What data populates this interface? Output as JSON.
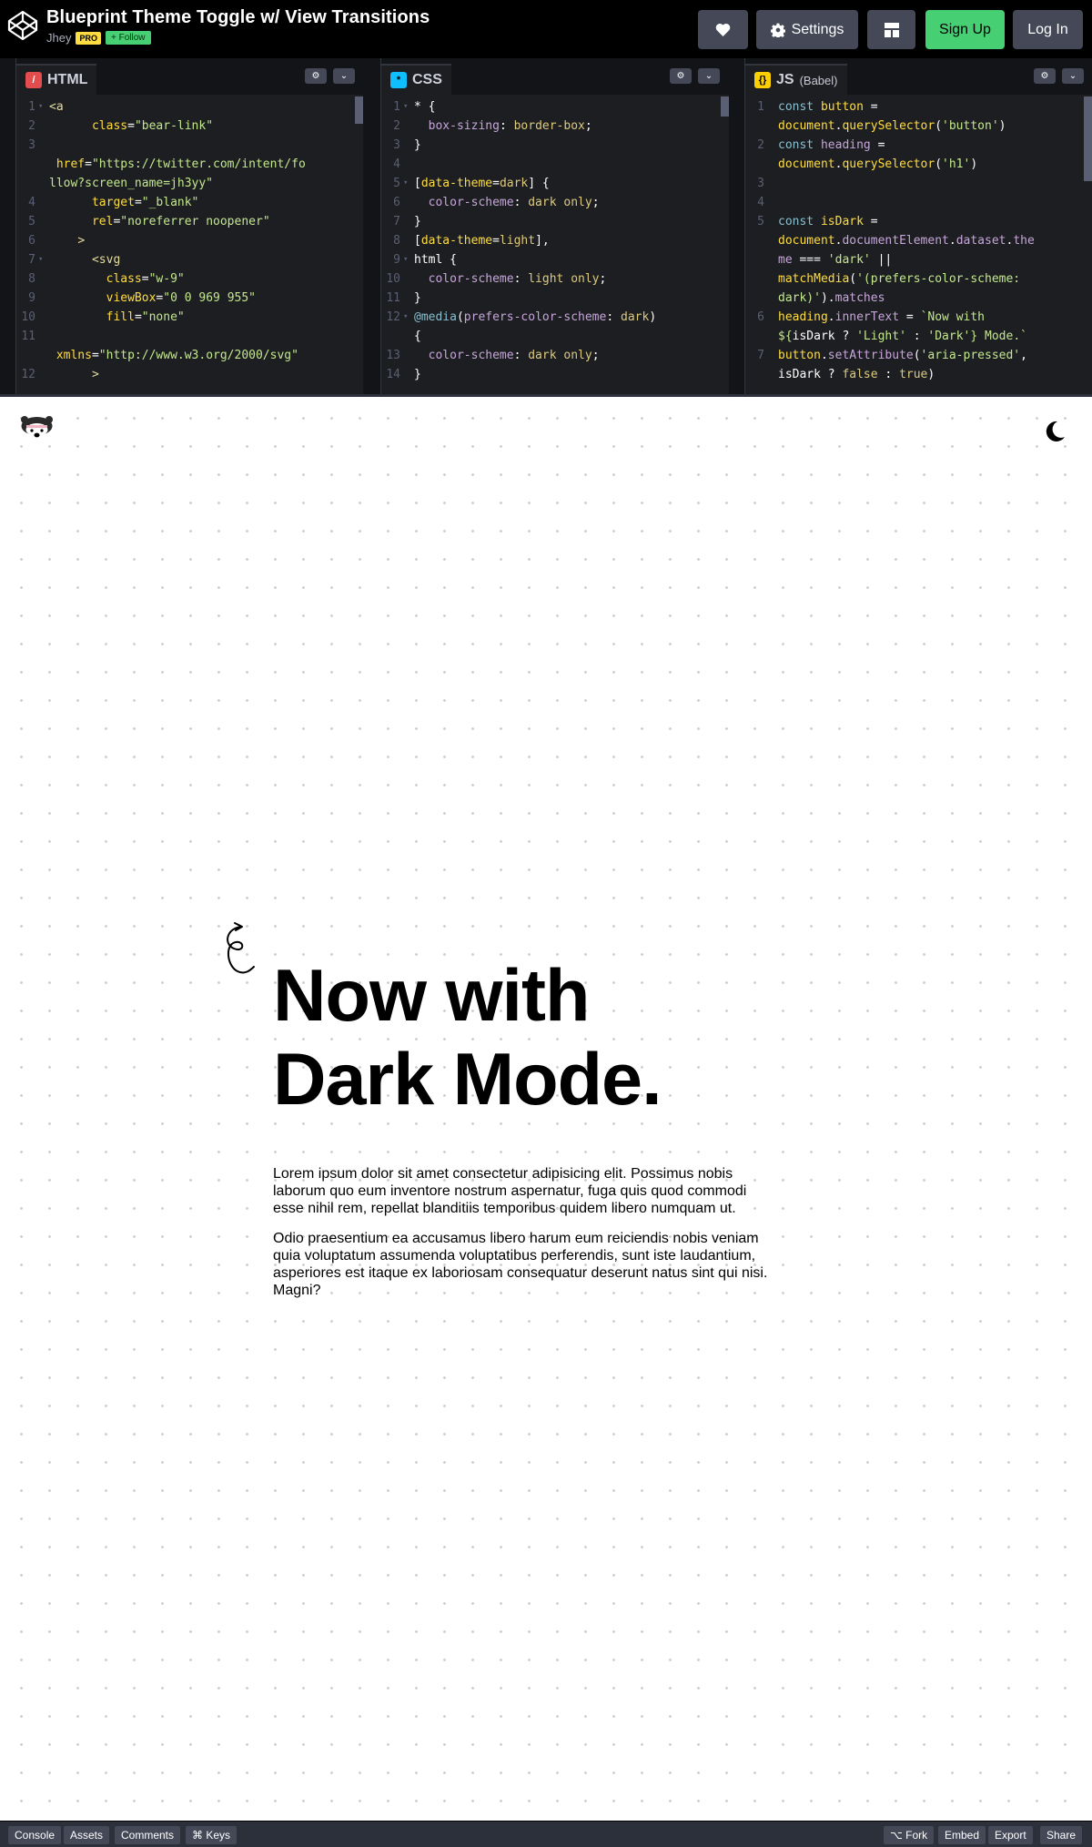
{
  "header": {
    "pen_title": "Blueprint Theme Toggle w/ View Transitions",
    "author": "Jhey",
    "pro_badge": "PRO",
    "follow_label": "+ Follow",
    "settings_label": "Settings",
    "signup_label": "Sign Up",
    "login_label": "Log In"
  },
  "editors": {
    "html": {
      "tab_label": "HTML",
      "lines": [
        {
          "n": "1",
          "fold": "▾",
          "segs": [
            [
              "c-tag",
              "<a"
            ]
          ]
        },
        {
          "n": "2",
          "fold": "",
          "segs": [
            [
              "txt",
              "      "
            ],
            [
              "c-attr",
              "class"
            ],
            [
              "txt",
              "="
            ],
            [
              "c-str2",
              "\"bear-link\""
            ]
          ]
        },
        {
          "n": "3",
          "fold": "",
          "segs": [
            [
              "txt",
              ""
            ]
          ]
        },
        {
          "n": "",
          "fold": "",
          "segs": [
            [
              "txt",
              " "
            ],
            [
              "c-attr",
              "href"
            ],
            [
              "txt",
              "="
            ],
            [
              "c-str2",
              "\"https://twitter.com/intent/fo"
            ]
          ]
        },
        {
          "n": "",
          "fold": "",
          "segs": [
            [
              "c-str2",
              "llow?screen_name=jh3yy\""
            ]
          ]
        },
        {
          "n": "4",
          "fold": "",
          "segs": [
            [
              "txt",
              "      "
            ],
            [
              "c-attr",
              "target"
            ],
            [
              "txt",
              "="
            ],
            [
              "c-str2",
              "\"_blank\""
            ]
          ]
        },
        {
          "n": "5",
          "fold": "",
          "segs": [
            [
              "txt",
              "      "
            ],
            [
              "c-attr",
              "rel"
            ],
            [
              "txt",
              "="
            ],
            [
              "c-str2",
              "\"noreferrer noopener\""
            ]
          ]
        },
        {
          "n": "6",
          "fold": "",
          "segs": [
            [
              "txt",
              "    "
            ],
            [
              "c-tag",
              ">"
            ]
          ]
        },
        {
          "n": "7",
          "fold": "▾",
          "segs": [
            [
              "txt",
              "      "
            ],
            [
              "c-tag",
              "<svg"
            ]
          ]
        },
        {
          "n": "8",
          "fold": "",
          "segs": [
            [
              "txt",
              "        "
            ],
            [
              "c-attr",
              "class"
            ],
            [
              "txt",
              "="
            ],
            [
              "c-str2",
              "\"w-9\""
            ]
          ]
        },
        {
          "n": "9",
          "fold": "",
          "segs": [
            [
              "txt",
              "        "
            ],
            [
              "c-attr",
              "viewBox"
            ],
            [
              "txt",
              "="
            ],
            [
              "c-str2",
              "\"0 0 969 955\""
            ]
          ]
        },
        {
          "n": "10",
          "fold": "",
          "segs": [
            [
              "txt",
              "        "
            ],
            [
              "c-attr",
              "fill"
            ],
            [
              "txt",
              "="
            ],
            [
              "c-str2",
              "\"none\""
            ]
          ]
        },
        {
          "n": "11",
          "fold": "",
          "segs": [
            [
              "txt",
              ""
            ]
          ]
        },
        {
          "n": "",
          "fold": "",
          "segs": [
            [
              "txt",
              " "
            ],
            [
              "c-attr",
              "xmlns"
            ],
            [
              "txt",
              "="
            ],
            [
              "c-str2",
              "\"http://www.w3.org/2000/svg\""
            ]
          ]
        },
        {
          "n": "12",
          "fold": "",
          "segs": [
            [
              "txt",
              "      "
            ],
            [
              "c-tag",
              ">"
            ]
          ]
        }
      ]
    },
    "css": {
      "tab_label": "CSS",
      "lines": [
        {
          "n": "1",
          "fold": "▾",
          "segs": [
            [
              "txt",
              "* {"
            ]
          ]
        },
        {
          "n": "2",
          "fold": "",
          "segs": [
            [
              "txt",
              "  "
            ],
            [
              "c-prop",
              "box-sizing"
            ],
            [
              "txt",
              ": "
            ],
            [
              "c-kw",
              "border-box"
            ],
            [
              "txt",
              ";"
            ]
          ]
        },
        {
          "n": "3",
          "fold": "",
          "segs": [
            [
              "txt",
              "}"
            ]
          ]
        },
        {
          "n": "4",
          "fold": "",
          "segs": [
            [
              "txt",
              ""
            ]
          ]
        },
        {
          "n": "5",
          "fold": "▾",
          "segs": [
            [
              "txt",
              "["
            ],
            [
              "c-sel",
              "data-theme"
            ],
            [
              "txt",
              "="
            ],
            [
              "c-kw",
              "dark"
            ],
            [
              "txt",
              "] {"
            ]
          ]
        },
        {
          "n": "6",
          "fold": "",
          "segs": [
            [
              "txt",
              "  "
            ],
            [
              "c-prop",
              "color-scheme"
            ],
            [
              "txt",
              ": "
            ],
            [
              "c-kw",
              "dark only"
            ],
            [
              "txt",
              ";"
            ]
          ]
        },
        {
          "n": "7",
          "fold": "",
          "segs": [
            [
              "txt",
              "}"
            ]
          ]
        },
        {
          "n": "8",
          "fold": "",
          "segs": [
            [
              "txt",
              "["
            ],
            [
              "c-sel",
              "data-theme"
            ],
            [
              "txt",
              "="
            ],
            [
              "c-kw",
              "light"
            ],
            [
              "txt",
              "],"
            ]
          ]
        },
        {
          "n": "9",
          "fold": "▾",
          "segs": [
            [
              "txt",
              "html {"
            ]
          ]
        },
        {
          "n": "10",
          "fold": "",
          "segs": [
            [
              "txt",
              "  "
            ],
            [
              "c-prop",
              "color-scheme"
            ],
            [
              "txt",
              ": "
            ],
            [
              "c-kw",
              "light only"
            ],
            [
              "txt",
              ";"
            ]
          ]
        },
        {
          "n": "11",
          "fold": "",
          "segs": [
            [
              "txt",
              "}"
            ]
          ]
        },
        {
          "n": "12",
          "fold": "▾",
          "segs": [
            [
              "c-key",
              "@media"
            ],
            [
              "txt",
              "("
            ],
            [
              "c-prop",
              "prefers-color-scheme"
            ],
            [
              "txt",
              ": "
            ],
            [
              "c-kw",
              "dark"
            ],
            [
              "txt",
              ")"
            ]
          ]
        },
        {
          "n": "",
          "fold": "",
          "segs": [
            [
              "txt",
              "{"
            ]
          ]
        },
        {
          "n": "13",
          "fold": "",
          "segs": [
            [
              "txt",
              "  "
            ],
            [
              "c-prop",
              "color-scheme"
            ],
            [
              "txt",
              ": "
            ],
            [
              "c-kw",
              "dark only"
            ],
            [
              "txt",
              ";"
            ]
          ]
        },
        {
          "n": "14",
          "fold": "",
          "segs": [
            [
              "txt",
              "}"
            ]
          ]
        }
      ]
    },
    "js": {
      "tab_label": "JS",
      "tab_sub": "(Babel)",
      "lines": [
        {
          "n": "1",
          "fold": "",
          "segs": [
            [
              "c-key",
              "const "
            ],
            [
              "c-fn",
              "button"
            ],
            [
              "txt",
              " ="
            ]
          ]
        },
        {
          "n": "",
          "fold": "",
          "segs": [
            [
              "c-fn",
              "document"
            ],
            [
              "txt",
              "."
            ],
            [
              "c-fn",
              "querySelector"
            ],
            [
              "txt",
              "("
            ],
            [
              "c-str2",
              "'button'"
            ],
            [
              "txt",
              ")"
            ]
          ]
        },
        {
          "n": "2",
          "fold": "",
          "segs": [
            [
              "c-key",
              "const "
            ],
            [
              "c-prop",
              "heading"
            ],
            [
              "txt",
              " ="
            ]
          ]
        },
        {
          "n": "",
          "fold": "",
          "segs": [
            [
              "c-fn",
              "document"
            ],
            [
              "txt",
              "."
            ],
            [
              "c-fn",
              "querySelector"
            ],
            [
              "txt",
              "("
            ],
            [
              "c-str2",
              "'h1'"
            ],
            [
              "txt",
              ")"
            ]
          ]
        },
        {
          "n": "3",
          "fold": "",
          "segs": [
            [
              "txt",
              ""
            ]
          ]
        },
        {
          "n": "4",
          "fold": "",
          "segs": [
            [
              "txt",
              ""
            ]
          ]
        },
        {
          "n": "5",
          "fold": "",
          "segs": [
            [
              "c-key",
              "const "
            ],
            [
              "c-fn",
              "isDark"
            ],
            [
              "txt",
              " ="
            ]
          ]
        },
        {
          "n": "",
          "fold": "",
          "segs": [
            [
              "c-fn",
              "document"
            ],
            [
              "txt",
              "."
            ],
            [
              "c-prop",
              "documentElement"
            ],
            [
              "txt",
              "."
            ],
            [
              "c-prop",
              "dataset"
            ],
            [
              "txt",
              "."
            ],
            [
              "c-prop",
              "the"
            ]
          ]
        },
        {
          "n": "",
          "fold": "",
          "segs": [
            [
              "c-prop",
              "me"
            ],
            [
              "txt",
              " === "
            ],
            [
              "c-str2",
              "'dark'"
            ],
            [
              "txt",
              " ||"
            ]
          ]
        },
        {
          "n": "",
          "fold": "",
          "segs": [
            [
              "c-fn",
              "matchMedia"
            ],
            [
              "txt",
              "("
            ],
            [
              "c-str2",
              "'(prefers-color-scheme:"
            ]
          ]
        },
        {
          "n": "",
          "fold": "",
          "segs": [
            [
              "c-str2",
              "dark)'"
            ],
            [
              "txt",
              ")."
            ],
            [
              "c-prop",
              "matches"
            ]
          ]
        },
        {
          "n": "6",
          "fold": "",
          "segs": [
            [
              "c-fn",
              "heading"
            ],
            [
              "txt",
              "."
            ],
            [
              "c-prop",
              "innerText"
            ],
            [
              "txt",
              " = "
            ],
            [
              "c-str2",
              "`Now with"
            ]
          ]
        },
        {
          "n": "",
          "fold": "",
          "segs": [
            [
              "c-str2",
              "${"
            ],
            [
              "txt",
              "isDark ? "
            ],
            [
              "c-str2",
              "'Light'"
            ],
            [
              "txt",
              " : "
            ],
            [
              "c-str2",
              "'Dark'"
            ],
            [
              "c-str2",
              "} Mode.`"
            ]
          ]
        },
        {
          "n": "7",
          "fold": "",
          "segs": [
            [
              "c-fn",
              "button"
            ],
            [
              "txt",
              "."
            ],
            [
              "c-prop",
              "setAttribute"
            ],
            [
              "txt",
              "("
            ],
            [
              "c-str2",
              "'aria-pressed'"
            ],
            [
              "txt",
              ","
            ]
          ]
        },
        {
          "n": "",
          "fold": "",
          "segs": [
            [
              "txt",
              "isDark ? "
            ],
            [
              "c-kw",
              "false"
            ],
            [
              "txt",
              " : "
            ],
            [
              "c-kw",
              "true"
            ],
            [
              "txt",
              ")"
            ]
          ]
        }
      ]
    }
  },
  "preview": {
    "heading_line1": "Now with",
    "heading_line2": "Dark Mode.",
    "paragraph1": "Lorem ipsum dolor sit amet consectetur adipisicing elit. Possimus nobis laborum quo eum inventore nostrum aspernatur, fuga quis quod commodi esse nihil rem, repellat blanditiis temporibus quidem libero numquam ut.",
    "paragraph2": "Odio praesentium ea accusamus libero harum eum reiciendis nobis veniam quia voluptatum assumenda voluptatibus perferendis, sunt iste laudantium, asperiores est itaque ex laboriosam consequatur deserunt natus sint qui nisi. Magni?"
  },
  "footer": {
    "console_label": "Console",
    "assets_label": "Assets",
    "comments_label": "Comments",
    "keys_label": "⌘ Keys",
    "fork_label": "⌥ Fork",
    "embed_label": "Embed",
    "export_label": "Export",
    "share_label": "Share"
  },
  "colors": {
    "header_bg": "#000000",
    "editor_bg": "#1d1e22",
    "signup_green": "#47cf73",
    "pro_yellow": "#ffdd40"
  }
}
